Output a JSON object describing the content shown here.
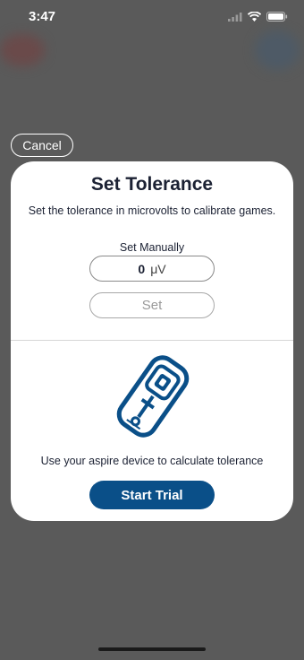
{
  "status_bar": {
    "time": "3:47"
  },
  "cancel_label": "Cancel",
  "modal": {
    "title": "Set Tolerance",
    "subtitle": "Set the tolerance in microvolts to calibrate games.",
    "manual_label": "Set Manually",
    "tolerance_value": "0",
    "tolerance_unit": "μV",
    "set_label": "Set",
    "device_text": "Use your aspire device to calculate tolerance",
    "start_label": "Start Trial"
  },
  "colors": {
    "accent": "#0a4f88",
    "overlay": "#5a5a5a"
  },
  "icons": [
    "signal-icon",
    "wifi-icon",
    "battery-icon",
    "aspire-device-icon"
  ]
}
